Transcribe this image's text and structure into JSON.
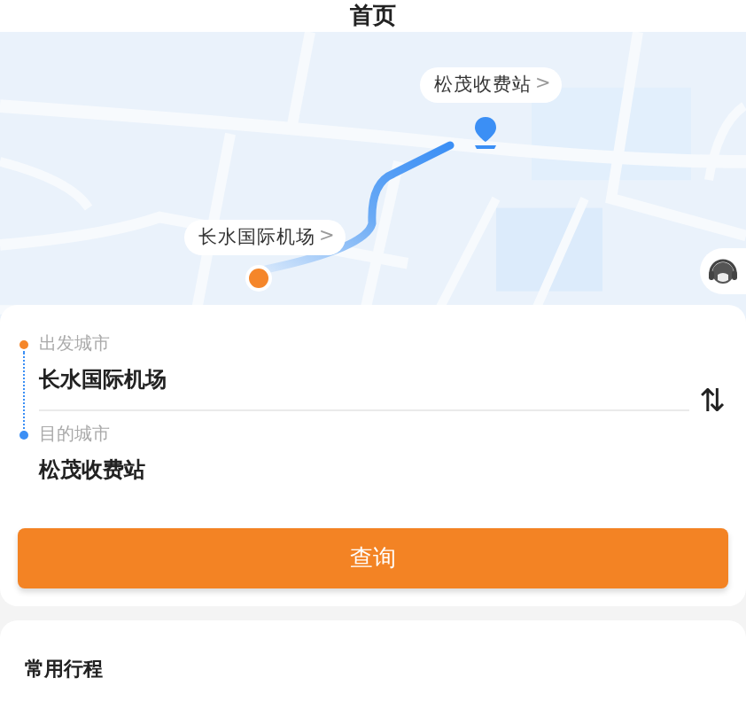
{
  "header": {
    "title": "首页"
  },
  "map": {
    "kind": "picture",
    "origin_label": "长水国际机场",
    "origin_chevron": ">",
    "destination_label": "松茂收费站",
    "destination_chevron": ">"
  },
  "route_form": {
    "fields": [
      {
        "kind": "origin",
        "label": "出发城市",
        "value": "长水国际机场"
      },
      {
        "kind": "destination",
        "label": "目的城市",
        "value": "松茂收费站"
      }
    ],
    "swap_glyph": "⇅",
    "query_button": "查询"
  },
  "frequent_trips": {
    "title": "常用行程"
  }
}
